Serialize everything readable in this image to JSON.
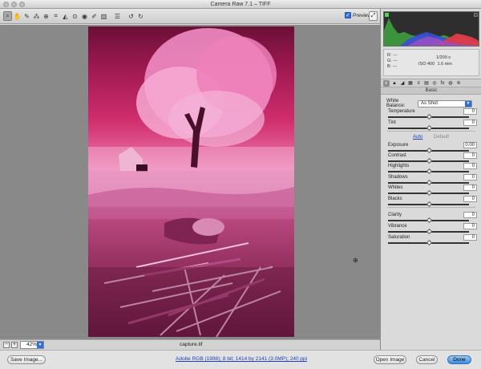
{
  "window": {
    "title": "Camera Raw 7.1  –  TIFF"
  },
  "toolbar": {
    "tools": [
      {
        "icon": "zoom-icon",
        "glyph": "⌕",
        "active": true
      },
      {
        "icon": "hand-icon",
        "glyph": "✋",
        "active": false
      },
      {
        "icon": "white-balance-icon",
        "glyph": "✎",
        "active": false
      },
      {
        "icon": "color-sampler-icon",
        "glyph": "⁂",
        "active": false
      },
      {
        "icon": "target-adjustment-icon",
        "glyph": "⊕",
        "active": false
      },
      {
        "icon": "crop-icon",
        "glyph": "⌗",
        "active": false
      },
      {
        "icon": "straighten-icon",
        "glyph": "◭",
        "active": false
      },
      {
        "icon": "spot-removal-icon",
        "glyph": "⊙",
        "active": false
      },
      {
        "icon": "red-eye-icon",
        "glyph": "◉",
        "active": false
      },
      {
        "icon": "adjustment-brush-icon",
        "glyph": "✐",
        "active": false
      },
      {
        "icon": "graduated-filter-icon",
        "glyph": "▥",
        "active": false
      },
      {
        "icon": "preferences-icon",
        "glyph": "☰",
        "active": false
      },
      {
        "icon": "rotate-ccw-icon",
        "glyph": "↺",
        "active": false
      },
      {
        "icon": "rotate-cw-icon",
        "glyph": "↻",
        "active": false
      }
    ],
    "preview_label": "Preview",
    "preview_checked": true,
    "fullscreen_glyph": "⤢"
  },
  "status": {
    "zoom": "42%",
    "filename": "capture.tif",
    "zoom_out": "−",
    "zoom_in": "+"
  },
  "bottom": {
    "save_label": "Save Image...",
    "settings_link": "Adobe RGB (1998); 8 bit; 1414 by 2141 (3.0MP); 240 ppi",
    "open_label": "Open Image",
    "cancel_label": "Cancel",
    "done_label": "Done"
  },
  "info": {
    "r": "R:  ---",
    "g": "G:  ---",
    "b": "B:  ---",
    "exp_a": "",
    "shutter": "1/200 s",
    "iso": "ISO 400",
    "focal": "1.6 mm"
  },
  "panel": {
    "tabs": [
      "◐",
      "▲",
      "◢",
      "▦",
      "≡",
      "▤",
      "◎",
      "fx",
      "◍",
      "≋"
    ],
    "section_title": "Basic",
    "wb_label": "White Balance:",
    "wb_value": "As Shot",
    "auto_label": "Auto",
    "default_label": "Default"
  },
  "sliders": [
    {
      "label": "Temperature",
      "value": "0",
      "pos": 0.5,
      "track": "temp"
    },
    {
      "label": "Tint",
      "value": "0",
      "pos": 0.5,
      "track": "tint"
    },
    {
      "label": "Exposure",
      "value": "0.00",
      "pos": 0.5,
      "track": "plain"
    },
    {
      "label": "Contrast",
      "value": "0",
      "pos": 0.5,
      "track": "plain"
    },
    {
      "label": "Highlights",
      "value": "0",
      "pos": 0.5,
      "track": "plain"
    },
    {
      "label": "Shadows",
      "value": "0",
      "pos": 0.5,
      "track": "plain"
    },
    {
      "label": "Whites",
      "value": "0",
      "pos": 0.5,
      "track": "plain"
    },
    {
      "label": "Blacks",
      "value": "0",
      "pos": 0.5,
      "track": "plain"
    },
    {
      "label": "Clarity",
      "value": "0",
      "pos": 0.5,
      "track": "plain"
    },
    {
      "label": "Vibrance",
      "value": "0",
      "pos": 0.5,
      "track": "vib"
    },
    {
      "label": "Saturation",
      "value": "0",
      "pos": 0.5,
      "track": "sat"
    }
  ],
  "colors": {
    "accent": "#2f6fd6",
    "photo_tint": "#e0559a",
    "histogram_bg": "#2e2e2e"
  }
}
